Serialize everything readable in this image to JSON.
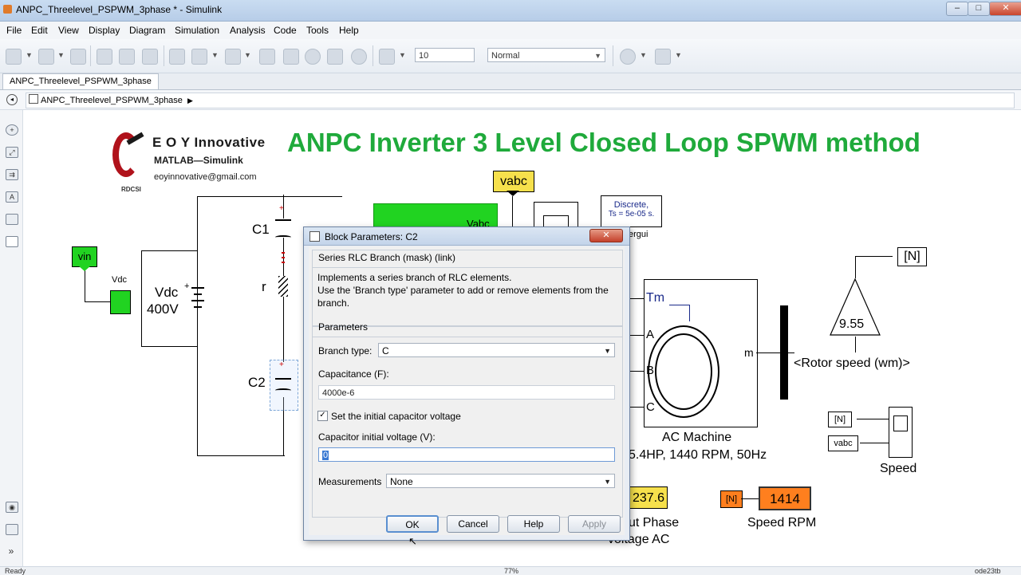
{
  "window": {
    "title": "ANPC_Threelevel_PSPWM_3phase * - Simulink",
    "min": "–",
    "max": "□",
    "close": "✕"
  },
  "menu": [
    "File",
    "Edit",
    "View",
    "Display",
    "Diagram",
    "Simulation",
    "Analysis",
    "Code",
    "Tools",
    "Help"
  ],
  "toolbar": {
    "stop_time": "10",
    "sim_mode": "Normal"
  },
  "tab": {
    "label": "ANPC_Threelevel_PSPWM_3phase"
  },
  "breadcrumb": {
    "model": "ANPC_Threelevel_PSPWM_3phase",
    "arrow": "▶"
  },
  "logo": {
    "line1": "E O Y Innovative",
    "line2": "MATLAB—Simulink",
    "line3": "eoyinnovative@gmail.com",
    "mark": "RDCSI"
  },
  "diagram": {
    "title": "ANPC Inverter 3 Level Closed Loop SPWM method",
    "vabc_tag": "vabc",
    "vdc_block": "Vdc",
    "vdc_label": "Vdc",
    "vdc_value": "400V",
    "vin_tag": "vin",
    "c1": "C1",
    "r": "r",
    "c2": "C2",
    "vabc_partial": "Vabc",
    "powergui_line1": "Discrete,",
    "powergui_line2": "Ts = 5e-05 s.",
    "powergui_name": "ergui",
    "tm": "Tm",
    "port_a": "A",
    "port_b": "B",
    "port_c": "C",
    "port_m": "m",
    "machine_name": "AC Machine",
    "machine_spec": "5.4HP, 1440 RPM, 50Hz",
    "gain_value": "9.55",
    "n_tag": "[N]",
    "rotor_speed": "<Rotor speed (wm)>",
    "scope_in_n": "[N]",
    "scope_in_vabc": "vabc",
    "scope_name": "Speed",
    "display_voltage": "237.6",
    "voltage_label_1": "ut Phase",
    "voltage_label_2": "voltage AC",
    "speed_tag": "[N]",
    "display_speed": "1414",
    "speed_label": "Speed RPM"
  },
  "dialog": {
    "title": "Block Parameters: C2",
    "close": "✕",
    "header": "Series RLC Branch (mask) (link)",
    "desc1": "Implements a series branch of RLC elements.",
    "desc2": "Use the 'Branch type' parameter to add or remove elements from the",
    "desc3": "branch.",
    "params_title": "Parameters",
    "branch_type_label": "Branch type:",
    "branch_type_value": "C",
    "capacitance_label": "Capacitance (F):",
    "capacitance_value": "4000e-6",
    "initial_voltage_check": "Set the initial capacitor voltage",
    "initial_voltage_label": "Capacitor initial voltage (V):",
    "initial_voltage_value": "0",
    "measurements_label": "Measurements",
    "measurements_value": "None",
    "ok": "OK",
    "cancel": "Cancel",
    "help": "Help",
    "apply": "Apply"
  },
  "status": {
    "left": "Ready",
    "zoom": "77%",
    "solver": "ode23tb"
  },
  "colors": {
    "title_green": "#1faa3b",
    "block_green": "#21d321",
    "tag_yellow": "#f6e04c",
    "display_orange": "#ff7f1e",
    "dialog_bg": "#f0f0f0"
  }
}
